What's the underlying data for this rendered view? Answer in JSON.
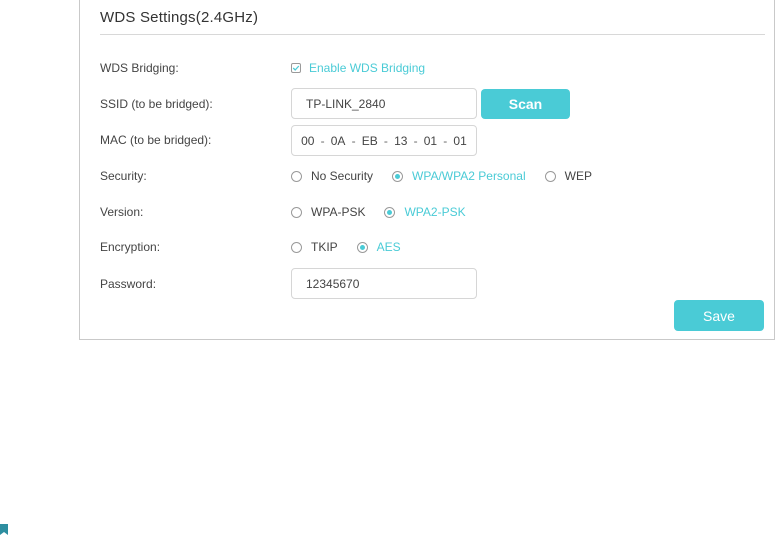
{
  "panel": {
    "title": "WDS Settings(2.4GHz)"
  },
  "wds_bridging": {
    "label": "WDS Bridging:",
    "checkbox_label": "Enable WDS Bridging",
    "checked": true
  },
  "ssid": {
    "label": "SSID (to be bridged):",
    "value": "TP-LINK_2840",
    "scan_label": "Scan"
  },
  "mac": {
    "label": "MAC (to be bridged):",
    "octets": [
      "00",
      "0A",
      "EB",
      "13",
      "01",
      "01"
    ],
    "separator": "-"
  },
  "security": {
    "label": "Security:",
    "options": [
      "No Security",
      "WPA/WPA2 Personal",
      "WEP"
    ],
    "selected": "WPA/WPA2 Personal"
  },
  "version": {
    "label": "Version:",
    "options": [
      "WPA-PSK",
      "WPA2-PSK"
    ],
    "selected": "WPA2-PSK"
  },
  "encryption": {
    "label": "Encryption:",
    "options": [
      "TKIP",
      "AES"
    ],
    "selected": "AES"
  },
  "password": {
    "label": "Password:",
    "value": "12345670"
  },
  "save_label": "Save",
  "colors": {
    "accent": "#4acbd6",
    "border": "#d6d6d6",
    "text": "#444444"
  },
  "icons": {
    "checkbox": "check-icon",
    "footer": "bookmark-icon"
  }
}
